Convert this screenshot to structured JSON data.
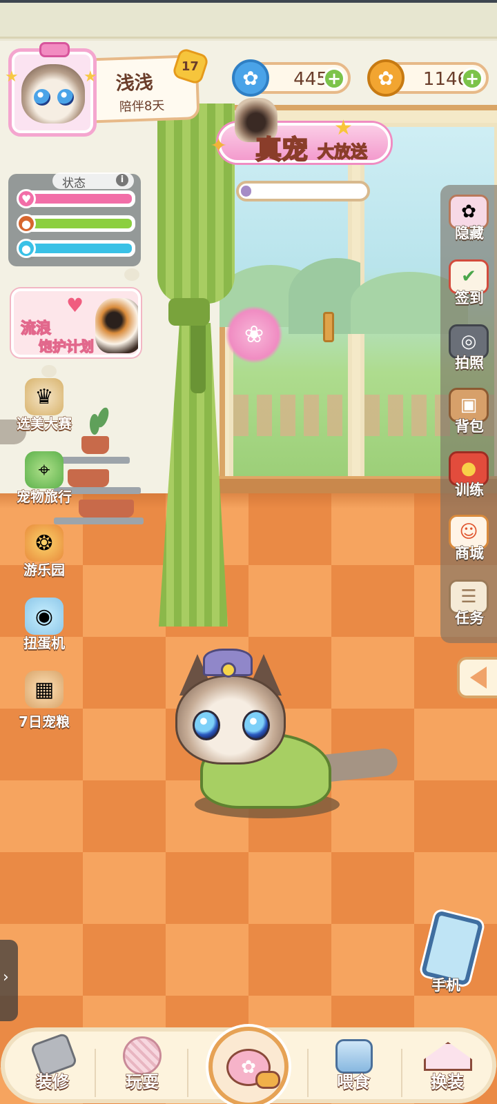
{
  "profile": {
    "name": "浅浅",
    "companion_days": "陪伴8天",
    "level": "17",
    "avatar_icon": "siamese-cat-avatar"
  },
  "currency": {
    "gems": {
      "value": "445",
      "icon": "paw-gem-icon",
      "color": "#4aa3e8"
    },
    "coins": {
      "value": "1146",
      "icon": "paw-coin-icon",
      "color": "#f2a531"
    },
    "plus_label": "+"
  },
  "event_banner": {
    "title_main": "真宠",
    "title_sub": "大放送",
    "progress": 0.08
  },
  "status_panel": {
    "title": "状态",
    "info_label": "i",
    "bars": [
      {
        "name": "mood",
        "icon": "heart-face-icon",
        "color": "#f26ea8",
        "value": 1.0
      },
      {
        "name": "hunger",
        "icon": "drumstick-icon",
        "color": "#8ccf3f",
        "value": 1.0
      },
      {
        "name": "thirst",
        "icon": "water-drop-icon",
        "color": "#39c1e6",
        "value": 1.0
      }
    ]
  },
  "promo": {
    "line1": "流浪",
    "line2": "饱护计划",
    "icon": "heart-icon"
  },
  "left_menu": [
    {
      "label": "选美大赛",
      "icon": "crown-throne-icon"
    },
    {
      "label": "宠物旅行",
      "icon": "map-pin-icon"
    },
    {
      "label": "游乐园",
      "icon": "ferris-wheel-icon"
    },
    {
      "label": "扭蛋机",
      "icon": "gacha-machine-icon"
    },
    {
      "label": "7日宠粮",
      "icon": "food-bowl-icon"
    }
  ],
  "right_menu": [
    {
      "label": "隐藏",
      "icon": "paw-frame-icon"
    },
    {
      "label": "签到",
      "icon": "calendar-check-icon"
    },
    {
      "label": "拍照",
      "icon": "camera-icon"
    },
    {
      "label": "背包",
      "icon": "backpack-icon"
    },
    {
      "label": "训练",
      "icon": "bell-collar-icon"
    },
    {
      "label": "商城",
      "icon": "lucky-cat-icon"
    },
    {
      "label": "任务",
      "icon": "clipboard-icon"
    }
  ],
  "phone": {
    "label": "手机",
    "icon": "phone-icon"
  },
  "bottom_nav": [
    {
      "label": "装修",
      "icon": "hammer-icon"
    },
    {
      "label": "玩耍",
      "icon": "yarn-ball-icon"
    },
    {
      "label": "",
      "icon": "paw-chat-icon"
    },
    {
      "label": "喂食",
      "icon": "pet-food-can-icon"
    },
    {
      "label": "换装",
      "icon": "clothes-hanger-icon"
    }
  ]
}
